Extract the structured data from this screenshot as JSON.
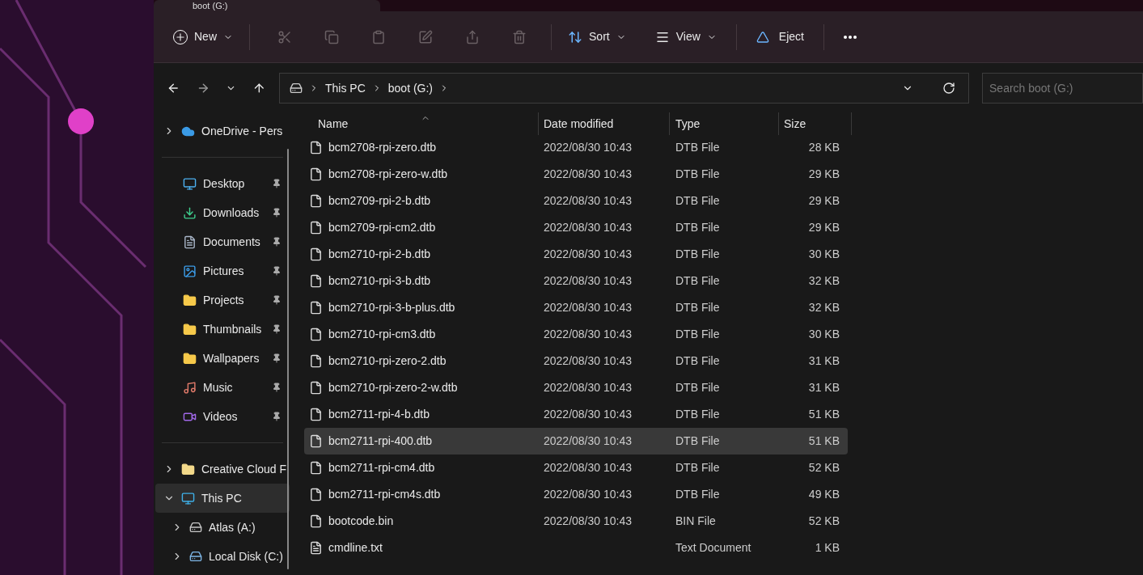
{
  "tab": {
    "title": "boot (G:)"
  },
  "toolbar": {
    "new": "New",
    "sort": "Sort",
    "view": "View",
    "eject": "Eject"
  },
  "address": {
    "crumbs": [
      "This PC",
      "boot (G:)"
    ],
    "search_placeholder": "Search boot (G:)"
  },
  "nav": {
    "top": [
      {
        "label": "OneDrive - Pers",
        "kind": "cloud",
        "expanded": false
      }
    ],
    "quick_access": [
      {
        "label": "Desktop",
        "kind": "desktop",
        "pinned": true
      },
      {
        "label": "Downloads",
        "kind": "downloads",
        "pinned": true
      },
      {
        "label": "Documents",
        "kind": "documents",
        "pinned": true
      },
      {
        "label": "Pictures",
        "kind": "pictures",
        "pinned": true
      },
      {
        "label": "Projects",
        "kind": "folder",
        "pinned": true
      },
      {
        "label": "Thumbnails",
        "kind": "folder",
        "pinned": true
      },
      {
        "label": "Wallpapers",
        "kind": "folder",
        "pinned": true
      },
      {
        "label": "Music",
        "kind": "music",
        "pinned": true
      },
      {
        "label": "Videos",
        "kind": "videos",
        "pinned": true
      }
    ],
    "bottom": [
      {
        "label": "Creative Cloud F",
        "kind": "cc",
        "expanded": false,
        "selected": false
      },
      {
        "label": "This PC",
        "kind": "pc",
        "expanded": true,
        "selected": true,
        "children": [
          {
            "label": "Atlas (A:)",
            "kind": "drive",
            "expanded": false,
            "selected": false
          },
          {
            "label": "Local Disk (C:)",
            "kind": "disk",
            "expanded": false,
            "selected": false
          }
        ]
      }
    ]
  },
  "table": {
    "columns": [
      "Name",
      "Date modified",
      "Type",
      "Size"
    ],
    "rows": [
      {
        "name": "bcm2708-rpi-zero.dtb",
        "date": "2022/08/30 10:43",
        "type": "DTB File",
        "size": "28 KB",
        "kind": "file",
        "selected": false
      },
      {
        "name": "bcm2708-rpi-zero-w.dtb",
        "date": "2022/08/30 10:43",
        "type": "DTB File",
        "size": "29 KB",
        "kind": "file",
        "selected": false
      },
      {
        "name": "bcm2709-rpi-2-b.dtb",
        "date": "2022/08/30 10:43",
        "type": "DTB File",
        "size": "29 KB",
        "kind": "file",
        "selected": false
      },
      {
        "name": "bcm2709-rpi-cm2.dtb",
        "date": "2022/08/30 10:43",
        "type": "DTB File",
        "size": "29 KB",
        "kind": "file",
        "selected": false
      },
      {
        "name": "bcm2710-rpi-2-b.dtb",
        "date": "2022/08/30 10:43",
        "type": "DTB File",
        "size": "30 KB",
        "kind": "file",
        "selected": false
      },
      {
        "name": "bcm2710-rpi-3-b.dtb",
        "date": "2022/08/30 10:43",
        "type": "DTB File",
        "size": "32 KB",
        "kind": "file",
        "selected": false
      },
      {
        "name": "bcm2710-rpi-3-b-plus.dtb",
        "date": "2022/08/30 10:43",
        "type": "DTB File",
        "size": "32 KB",
        "kind": "file",
        "selected": false
      },
      {
        "name": "bcm2710-rpi-cm3.dtb",
        "date": "2022/08/30 10:43",
        "type": "DTB File",
        "size": "30 KB",
        "kind": "file",
        "selected": false
      },
      {
        "name": "bcm2710-rpi-zero-2.dtb",
        "date": "2022/08/30 10:43",
        "type": "DTB File",
        "size": "31 KB",
        "kind": "file",
        "selected": false
      },
      {
        "name": "bcm2710-rpi-zero-2-w.dtb",
        "date": "2022/08/30 10:43",
        "type": "DTB File",
        "size": "31 KB",
        "kind": "file",
        "selected": false
      },
      {
        "name": "bcm2711-rpi-4-b.dtb",
        "date": "2022/08/30 10:43",
        "type": "DTB File",
        "size": "51 KB",
        "kind": "file",
        "selected": false
      },
      {
        "name": "bcm2711-rpi-400.dtb",
        "date": "2022/08/30 10:43",
        "type": "DTB File",
        "size": "51 KB",
        "kind": "file",
        "selected": true
      },
      {
        "name": "bcm2711-rpi-cm4.dtb",
        "date": "2022/08/30 10:43",
        "type": "DTB File",
        "size": "52 KB",
        "kind": "file",
        "selected": false
      },
      {
        "name": "bcm2711-rpi-cm4s.dtb",
        "date": "2022/08/30 10:43",
        "type": "DTB File",
        "size": "49 KB",
        "kind": "file",
        "selected": false
      },
      {
        "name": "bootcode.bin",
        "date": "2022/08/30 10:43",
        "type": "BIN File",
        "size": "52 KB",
        "kind": "file",
        "selected": false
      },
      {
        "name": "cmdline.txt",
        "type": "Text Document",
        "size": "1 KB",
        "kind": "text"
      }
    ]
  }
}
